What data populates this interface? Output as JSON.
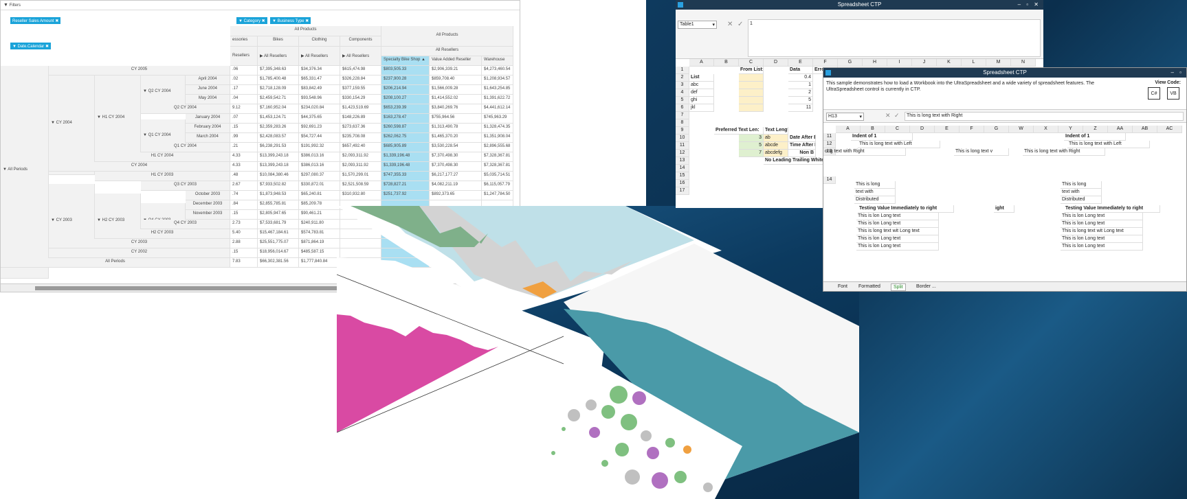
{
  "pivot": {
    "filters_label": "Filters",
    "chips": {
      "measure": "Reseller Sales Amount",
      "column1": "Category",
      "column2": "Business Type",
      "row": "Date.Calendar"
    },
    "col_headers": {
      "all_products": "All Products",
      "accessories": "essories",
      "bikes": "Bikes",
      "clothing": "Clothing",
      "components": "Components",
      "all_products_right": "All Products",
      "all_resellers": "All Resellers",
      "resellers_cut": "Resellers",
      "specialty": "Specialty Bike Shop",
      "value_added": "Value Added Reseller",
      "warehouse": "Warehouse"
    },
    "rows": [
      {
        "label": "CY 2005",
        "c0": ".06",
        "c1": "$7,395,348.63",
        "c2": "$34,376.34",
        "c3": "$615,474.98",
        "c4": "$803,505.33",
        "c5": "$2,906,339.21",
        "c6": "$4,273,460.54"
      },
      {
        "label": "April 2004",
        "c0": ".02",
        "c1": "$1,785,400.48",
        "c2": "$65,331.47",
        "c3": "$326,228.84",
        "c4": "$237,900.28",
        "c5": "$859,708.40",
        "c6": "$1,208,934.57"
      },
      {
        "label": "June 2004",
        "c0": ".17",
        "c1": "$2,718,128.09",
        "c2": "$83,842.49",
        "c3": "$377,159.55",
        "c4": "$206,214.94",
        "c5": "$1,566,009.28",
        "c6": "$1,643,254.85"
      },
      {
        "label": "May 2004",
        "c0": ".04",
        "c1": "$2,459,542.71",
        "c2": "$93,548.96",
        "c3": "$330,154.29",
        "c4": "$208,100.27",
        "c5": "$1,414,552.02",
        "c6": "$1,391,622.72"
      },
      {
        "label": "Q2 CY 2004",
        "c0": "9.12",
        "c1": "$7,160,952.04",
        "c2": "$234,020.84",
        "c3": "$1,423,519.69",
        "c4": "$653,239.39",
        "c5": "$3,840,269.76",
        "c6": "$4,441,612.14"
      },
      {
        "label": "January 2004",
        "c0": ".07",
        "c1": "$1,453,124.71",
        "c2": "$44,375.65",
        "c3": "$148,226.89",
        "c4": "$163,278.47",
        "c5": "$755,964.56",
        "c6": "$745,963.29"
      },
      {
        "label": "February 2004",
        "c0": ".15",
        "c1": "$2,359,283.26",
        "c2": "$92,691.23",
        "c3": "$273,637.36",
        "c4": "$260,598.87",
        "c5": "$1,313,490.78",
        "c6": "$1,328,474.35"
      },
      {
        "label": "March 2004",
        "c0": ".99",
        "c1": "$2,428,083.57",
        "c2": "$54,727.44",
        "c3": "$235,708.08",
        "c4": "$262,062.75",
        "c5": "$1,465,370.20",
        "c6": "$1,351,908.04"
      },
      {
        "label": "Q1 CY 2004",
        "c0": ".21",
        "c1": "$6,238,291.53",
        "c2": "$191,992.32",
        "c3": "$657,492.40",
        "c4": "$685,905.89",
        "c5": "$3,530,228.54",
        "c6": "$2,896,555.68"
      },
      {
        "label": "H1 CY 2004",
        "c0": "4.33",
        "c1": "$13,399,243.18",
        "c2": "$386,013.16",
        "c3": "$2,093,311.92",
        "c4": "$1,339,196.48",
        "c5": "$7,370,498.30",
        "c6": "$7,328,367.81"
      },
      {
        "label": "CY 2004",
        "c0": "4.33",
        "c1": "$13,399,243.18",
        "c2": "$386,013.16",
        "c3": "$2,093,311.92",
        "c4": "$1,339,196.48",
        "c5": "$7,370,498.30",
        "c6": "$7,328,367.81"
      },
      {
        "label": "H1 CY 2003",
        "c0": ".48",
        "c1": "$10,084,380.46",
        "c2": "$297,080.37",
        "c3": "$1,570,299.01",
        "c4": "$747,355.33",
        "c5": "$6,217,177.27",
        "c6": "$5,035,714.51"
      },
      {
        "label": "Q3 CY 2003",
        "c0": "2.67",
        "c1": "$7,933,502.82",
        "c2": "$330,872.01",
        "c3": "$2,521,508.59",
        "c4": "$728,827.21",
        "c5": "$4,082,211.19",
        "c6": "$6,115,057.79"
      },
      {
        "label": "October 2003",
        "c0": ".74",
        "c1": "$1,873,948.53",
        "c2": "$65,240.81",
        "c3": "$310,932.80",
        "c4": "$251,737.92",
        "c5": "$892,373.65",
        "c6": "$1,247,784.50"
      },
      {
        "label": "December 2003",
        "c0": ".84",
        "c1": "$2,855,785.81",
        "c2": "$85,209.78",
        "c3": "",
        "c4": "",
        "c5": "",
        "c6": ""
      },
      {
        "label": "November 2003",
        "c0": ".15",
        "c1": "$2,805,947.65",
        "c2": "$90,461.21",
        "c3": "",
        "c4": "",
        "c5": "",
        "c6": ""
      },
      {
        "label": "Q4 CY 2003",
        "c0": "2.73",
        "c1": "$7,533,681.79",
        "c2": "$240,911.80",
        "c3": "",
        "c4": "",
        "c5": "",
        "c6": ""
      },
      {
        "label": "H2 CY 2003",
        "c0": "5.40",
        "c1": "$15,467,184.61",
        "c2": "$574,783.81",
        "c3": "",
        "c4": "",
        "c5": "",
        "c6": ""
      },
      {
        "label": "CY 2003",
        "c0": "2.88",
        "c1": "$25,551,775.07",
        "c2": "$871,864.19",
        "c3": "",
        "c4": "",
        "c5": "",
        "c6": ""
      },
      {
        "label": "CY 2002",
        "c0": ".15",
        "c1": "$18,956,014.67",
        "c2": "$485,587.15",
        "c3": "",
        "c4": "",
        "c5": "",
        "c6": ""
      },
      {
        "label": "All Periods",
        "c0": "7.83",
        "c1": "$66,302,381.56",
        "c2": "$1,777,840.84",
        "c3": "",
        "c4": "",
        "c5": "",
        "c6": ""
      }
    ],
    "tree_labels": {
      "cy2004": "CY 2004",
      "h1cy2004": "H1 CY 2004",
      "q2cy2004": "Q2 CY 2004",
      "q1cy2004": "Q1 CY 2004",
      "cy2003": "CY 2003",
      "h2cy2003": "H2 CY 2003",
      "q4cy2003": "Q4 CY 2003",
      "all_periods": "All Periods"
    }
  },
  "ss1": {
    "title": "Spreadsheet CTP",
    "name_box": "Table1",
    "formula": "1",
    "columns": [
      "A",
      "B",
      "C",
      "D",
      "E",
      "F",
      "G",
      "H",
      "I",
      "J",
      "K",
      "L",
      "M",
      "N"
    ],
    "rows": [
      "1",
      "2",
      "3",
      "4",
      "5",
      "6",
      "7",
      "8",
      "9",
      "10",
      "11",
      "12",
      "13",
      "14",
      "15",
      "16",
      "17"
    ],
    "from_list": "From List:",
    "data": "Data",
    "error_cut": "Erro",
    "list_items": [
      "List",
      "abc",
      "def",
      "ghi",
      "jkl"
    ],
    "data_vals": [
      "0.4",
      "1",
      "2",
      "5",
      "11"
    ],
    "pref_text_len": "Preferred Text Len:",
    "text_length": "Text Length",
    "tl_vals": [
      "3",
      "5",
      "7"
    ],
    "tl_text": [
      "ab",
      "abcde",
      "abcdefg"
    ],
    "date_after": "Date After E",
    "time_after": "Time After E",
    "non_b": "Non B",
    "no_leading": "No Leading Trailing Whitesp"
  },
  "ss2": {
    "title": "Spreadsheet CTP",
    "desc": "This sample demonstrates how to load a Workbook into the UltraSpreadsheet and a wide variety of spreadsheet features. The UltraSpreadsheet control is currently in CTP.",
    "view_code": "View Code:",
    "cs_label": "C#",
    "vb_label": "VB",
    "name_box": "H13",
    "formula": "This is long text with Right",
    "columns_left": [
      "A",
      "B",
      "C",
      "D",
      "E",
      "F",
      "G"
    ],
    "columns_right": [
      "W",
      "X",
      "Y",
      "Z",
      "AA",
      "AB",
      "AC"
    ],
    "row_nums": [
      "11",
      "12",
      "13",
      "14"
    ],
    "indent": "Indent of 1",
    "long_left": "This is long text with Left",
    "long_right_cut": "ong text with Right",
    "long_cut": "This is long text v",
    "long_right2": "This is long text with Right",
    "dist_lines": [
      "This is long",
      "text with",
      "Distributed"
    ],
    "testing": "Testing Value Immediately to right",
    "ight": "ight",
    "lon_lines": [
      "This is lon Long text",
      "This is lon Long text",
      "This is long text wit Long text",
      "This is lon Long text",
      "This is lon Long text"
    ],
    "tabs": [
      "Font",
      "Formatted",
      "Split",
      "Border ..."
    ],
    "active_tab": "Split"
  },
  "colors": {
    "accent_blue": "#1aa3d9",
    "highlight": "#a9dff2",
    "titlebar": "#1f3a52",
    "pink": "#d94aa3",
    "teal": "#4a9aa8"
  }
}
